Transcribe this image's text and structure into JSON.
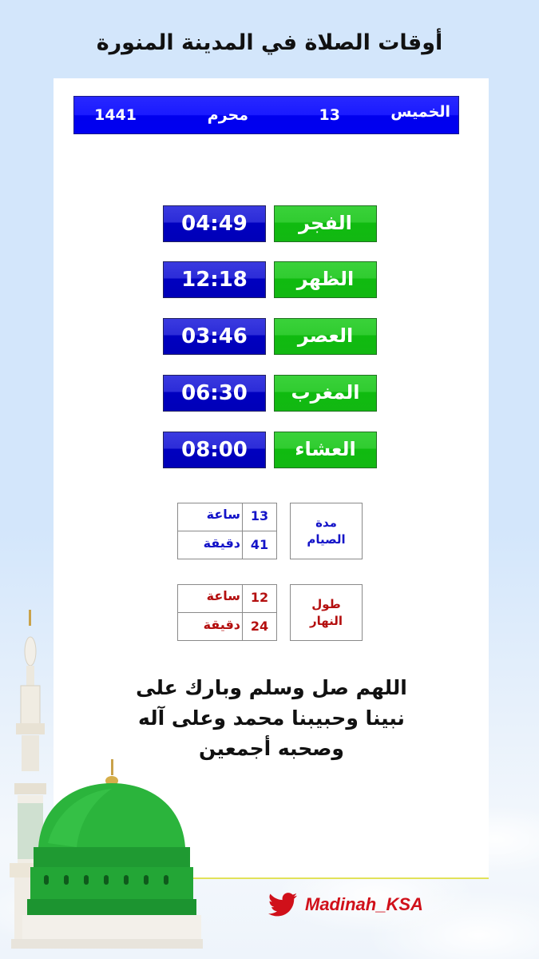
{
  "header": {
    "title": "أوقات الصلاة في المدينة المنورة"
  },
  "date_bar": {
    "day_name": "الخميس",
    "day_number": "13",
    "month": "محرم",
    "year": "1441",
    "color": "#0000ee"
  },
  "prayers": [
    {
      "name": "الفجر",
      "time": "04:49"
    },
    {
      "name": "الظهر",
      "time": "12:18"
    },
    {
      "name": "العصر",
      "time": "03:46"
    },
    {
      "name": "المغرب",
      "time": "06:30"
    },
    {
      "name": "العشاء",
      "time": "08:00"
    }
  ],
  "fasting_duration": {
    "label_line1": "مدة",
    "label_line2": "الصيام",
    "hours": "13",
    "hours_unit": "ساعة",
    "minutes": "41",
    "minutes_unit": "دقيقة",
    "color": "#1414c8"
  },
  "day_length": {
    "label_line1": "طول",
    "label_line2": "النهار",
    "hours": "12",
    "hours_unit": "ساعة",
    "minutes": "24",
    "minutes_unit": "دقيقة",
    "color": "#b40f0f"
  },
  "dua": {
    "line1": "اللهم صل وسلم وبارك على",
    "line2": "نبينا وحبيبنا محمد وعلى آله",
    "line3": "وصحبه أجمعين"
  },
  "footer": {
    "twitter_icon": "twitter-bird-icon",
    "handle": "Madinah_KSA"
  },
  "colors": {
    "prayer_name_bg": "#1fc41f",
    "prayer_time_bg": "#0000c0",
    "background": "#d3e6fb",
    "accent_line": "#e2e25a",
    "twitter_red": "#d0101a"
  }
}
